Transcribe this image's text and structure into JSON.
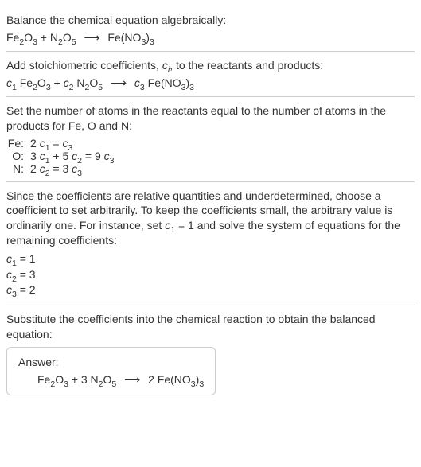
{
  "step1": {
    "text": "Balance the chemical equation algebraically:",
    "eq_html": "Fe<sub>2</sub>O<sub>3</sub> + N<sub>2</sub>O<sub>5</sub> <span class='arrow'>⟶</span> Fe(NO<sub>3</sub>)<sub>3</sub>"
  },
  "step2": {
    "text_html": "Add stoichiometric coefficients, <span class='ital'>c</span><span class='sub-i'>i</span>, to the reactants and products:",
    "eq_html": "<span class='ital'>c</span><sub>1</sub> Fe<sub>2</sub>O<sub>3</sub> + <span class='ital'>c</span><sub>2</sub> N<sub>2</sub>O<sub>5</sub> <span class='arrow'>⟶</span> <span class='ital'>c</span><sub>3</sub> Fe(NO<sub>3</sub>)<sub>3</sub>"
  },
  "step3": {
    "text": "Set the number of atoms in the reactants equal to the number of atoms in the products for Fe, O and N:",
    "rows": [
      {
        "label": "Fe:",
        "eq_html": "2 <span class='ital'>c</span><sub>1</sub> = <span class='ital'>c</span><sub>3</sub>"
      },
      {
        "label": "O:",
        "eq_html": "3 <span class='ital'>c</span><sub>1</sub> + 5 <span class='ital'>c</span><sub>2</sub> = 9 <span class='ital'>c</span><sub>3</sub>"
      },
      {
        "label": "N:",
        "eq_html": "2 <span class='ital'>c</span><sub>2</sub> = 3 <span class='ital'>c</span><sub>3</sub>"
      }
    ]
  },
  "step4": {
    "text_html": "Since the coefficients are relative quantities and underdetermined, choose a coefficient to set arbitrarily. To keep the coefficients small, the arbitrary value is ordinarily one. For instance, set <span class='ital'>c</span><sub>1</sub> = 1 and solve the system of equations for the remaining coefficients:",
    "coefs": [
      {
        "html": "<span class='ital'>c</span><sub>1</sub> = 1"
      },
      {
        "html": "<span class='ital'>c</span><sub>2</sub> = 3"
      },
      {
        "html": "<span class='ital'>c</span><sub>3</sub> = 2"
      }
    ]
  },
  "step5": {
    "text": "Substitute the coefficients into the chemical reaction to obtain the balanced equation:",
    "answer_label": "Answer:",
    "answer_eq_html": "Fe<sub>2</sub>O<sub>3</sub> + 3 N<sub>2</sub>O<sub>5</sub> <span class='arrow'>⟶</span> 2 Fe(NO<sub>3</sub>)<sub>3</sub>"
  }
}
